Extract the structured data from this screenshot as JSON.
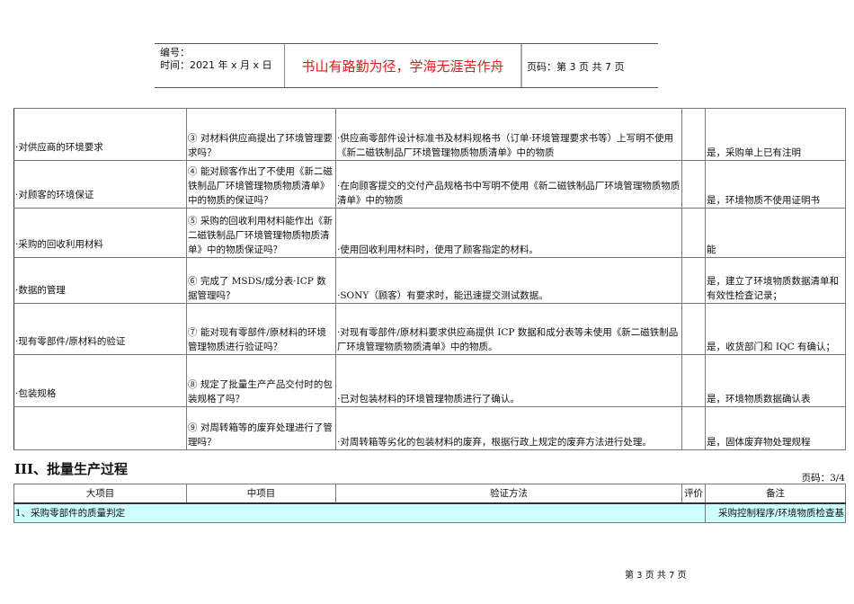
{
  "header": {
    "number_label": "编号：",
    "time_label": "时间：2021 年 x 月 x 日",
    "motto": "书山有路勤为径，学海无涯苦作舟",
    "page_label": "页码：第 3 页  共 7 页"
  },
  "rows": [
    {
      "item": "·对供应商的环境要求",
      "question": "③ 对材料供应商提出了环境管理要求吗？",
      "method": "·供应商零部件设计标准书及材料规格书（订单·环境管理要求书等）上写明不使用《新二磁铁制品厂环境管理物质物质清单》中的物质",
      "eval": "",
      "note": "是，采购单上已有注明"
    },
    {
      "item": "·对顾客的环境保证",
      "question": "④ 能对顾客作出了不使用《新二磁铁制品厂环境管理物质物质清单》中的物质的保证吗？",
      "method": "·在向顾客提交的交付产品规格书中写明不使用《新二磁铁制品厂环境管理物质物质清单》中的物质",
      "eval": "",
      "note": "是，环境物质不使用证明书"
    },
    {
      "item": "·采购的回收利用材料",
      "question": "⑤ 采购的回收利用材料能作出《新二磁铁制品厂环境管理物质物质清单》中的物质保证吗？",
      "method": "·使用回收利用材料时，使用了顾客指定的材料。",
      "eval": "",
      "note": "能"
    },
    {
      "item": "·数据的管理",
      "question": "⑥ 完成了 MSDS/成分表·ICP 数据管理吗？",
      "method": "·SONY（顾客）有要求时，能迅速提交测试数据。",
      "eval": "",
      "note": "是，建立了环境物质数据清单和有效性检查记录；"
    },
    {
      "item": "·现有零部件/原材料的验证",
      "question": "⑦ 能对现有零部件/原材料的环境管理物质进行验证吗？",
      "method": "·对现有零部件/原材料要求供应商提供 ICP 数据和成分表等未使用《新二磁铁制品厂环境管理物质物质清单》中的物质。",
      "eval": "",
      "note": "是，收货部门和 IQC 有确认；"
    },
    {
      "item": "·包装规格",
      "question": "⑧ 规定了批量生产产品交付时的包装规格了吗？",
      "method": "·已对包装材料的环境管理物质进行了确认。",
      "eval": "",
      "note": "是，环境物质数据确认表"
    },
    {
      "item": "",
      "question": "⑨ 对周转箱等的废弃处理进行了管理吗？",
      "method": "·对周转箱等劣化的包装材料的废弃，根据行政上规定的废弃方法进行处理。",
      "eval": "",
      "note": "是，固体废弃物处理规程"
    }
  ],
  "section": {
    "title": "III、批量生产过程",
    "page": "页码：3/4"
  },
  "table2": {
    "headers": [
      "大项目",
      "中项目",
      "验证方法",
      "评价",
      "备注"
    ],
    "row1": {
      "item": "1、采购零部件的质量判定",
      "note": "采购控制程序/环境物质检查基"
    }
  },
  "footer": "第 3 页 共 7 页"
}
